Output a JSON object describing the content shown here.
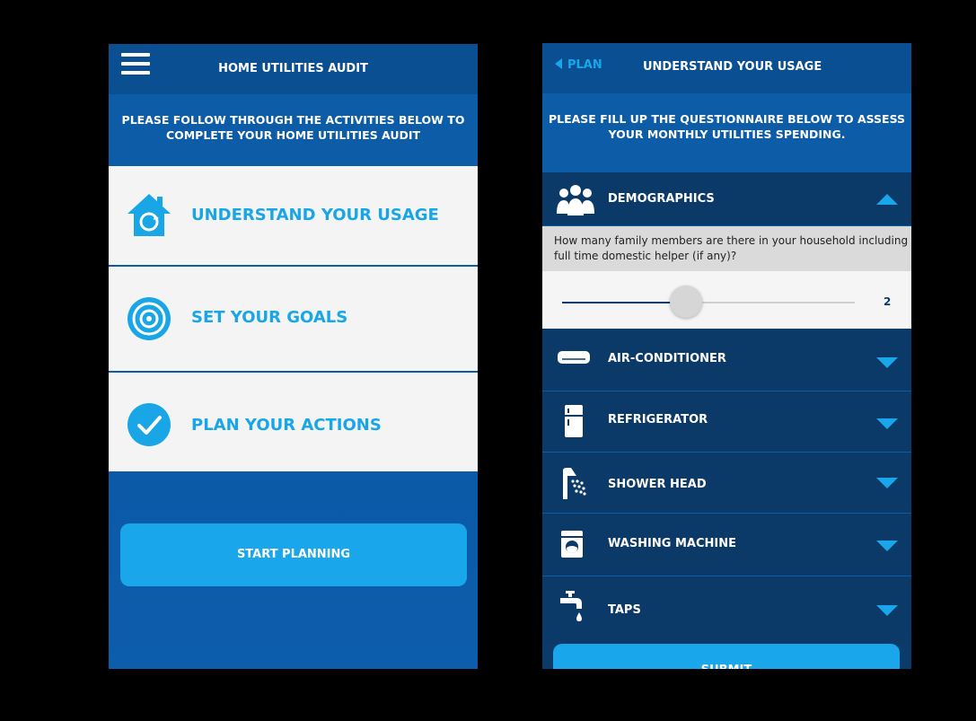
{
  "left": {
    "header": {
      "title": "HOME UTILITIES AUDIT"
    },
    "intro": "PLEASE FOLLOW THROUGH THE ACTIVITIES BELOW TO COMPLETE YOUR HOME UTILITIES AUDIT",
    "activities": [
      {
        "label": "UNDERSTAND YOUR USAGE",
        "icon": "house-icon"
      },
      {
        "label": "SET YOUR GOALS",
        "icon": "target-icon"
      },
      {
        "label": "PLAN YOUR ACTIONS",
        "icon": "check-icon"
      }
    ],
    "start_button": "START PLANNING"
  },
  "right": {
    "header": {
      "back_label": "PLAN",
      "title": "UNDERSTAND YOUR USAGE"
    },
    "intro": "PLEASE FILL UP THE QUESTIONNAIRE BELOW TO ASSESS YOUR MONTHLY UTILITIES SPENDING.",
    "sections": [
      {
        "name": "DEMOGRAPHICS",
        "icon": "people-icon",
        "expanded": true
      },
      {
        "name": "AIR-CONDITIONER",
        "icon": "air-conditioner-icon",
        "expanded": false
      },
      {
        "name": "REFRIGERATOR",
        "icon": "refrigerator-icon",
        "expanded": false
      },
      {
        "name": "SHOWER HEAD",
        "icon": "shower-icon",
        "expanded": false
      },
      {
        "name": "WASHING MACHINE",
        "icon": "washing-machine-icon",
        "expanded": false
      },
      {
        "name": "TAPS",
        "icon": "tap-icon",
        "expanded": false
      }
    ],
    "question": "How many family members are there in your household including full time domestic helper (if any)?",
    "slider": {
      "value": "2",
      "fraction": 0.42
    },
    "submit_button": "SUBMIT"
  },
  "colors": {
    "accent": "#1aa6ea",
    "header": "#0b4f93",
    "panel": "#0c3a68"
  }
}
